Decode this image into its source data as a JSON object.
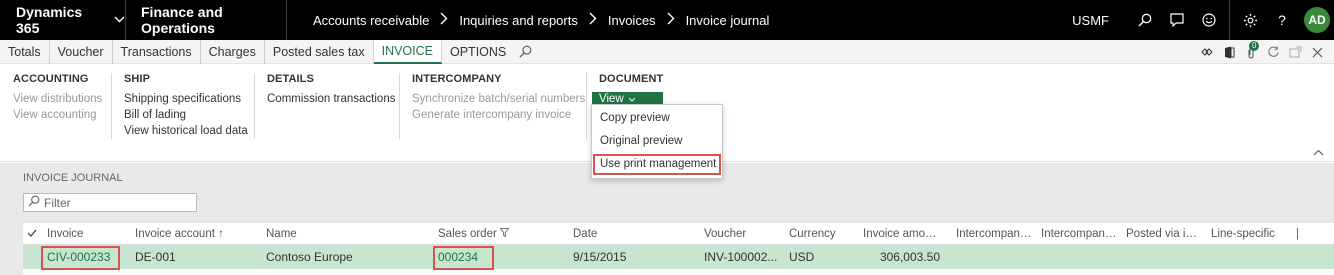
{
  "topbar": {
    "app_name": "Dynamics 365",
    "module_name": "Finance and Operations",
    "breadcrumbs": [
      "Accounts receivable",
      "Inquiries and reports",
      "Invoices",
      "Invoice journal"
    ],
    "company": "USMF",
    "avatar_initials": "AD"
  },
  "tabs": [
    "Totals",
    "Voucher",
    "Transactions",
    "Charges",
    "Posted sales tax",
    "INVOICE",
    "OPTIONS"
  ],
  "active_tab": "INVOICE",
  "notification_count": "0",
  "ribbon": {
    "accounting": {
      "header": "ACCOUNTING",
      "items": [
        "View distributions",
        "View accounting"
      ]
    },
    "ship": {
      "header": "SHIP",
      "items": [
        "Shipping specifications",
        "Bill of lading",
        "View historical load data"
      ]
    },
    "details": {
      "header": "DETAILS",
      "items": [
        "Commission transactions"
      ]
    },
    "intercompany": {
      "header": "INTERCOMPANY",
      "items": [
        "Synchronize batch/serial numbers",
        "Generate intercompany invoice"
      ]
    },
    "document": {
      "header": "DOCUMENT",
      "view_label": "View"
    }
  },
  "view_menu": {
    "items": [
      "Copy preview",
      "Original preview",
      "Use print management"
    ]
  },
  "journal": {
    "title": "INVOICE JOURNAL",
    "filter_placeholder": "Filter",
    "columns": [
      "Invoice",
      "Invoice account",
      "Name",
      "Sales order",
      "Date",
      "Voucher",
      "Currency",
      "Invoice amount",
      "Intercompany...",
      "Intercompany...",
      "Posted via int...",
      "Line-specific"
    ],
    "rows": [
      {
        "invoice": "CIV-000233",
        "invoice_account": "DE-001",
        "name": "Contoso Europe",
        "sales_order": "000234",
        "date": "9/15/2015",
        "voucher": "INV-100002...",
        "currency": "USD",
        "invoice_amount": "306,003.50"
      }
    ]
  },
  "colors": {
    "accent_green": "#217346",
    "highlight_red": "#d9534f",
    "row_selected": "#c7e5cf",
    "topbar_bg": "#000000"
  }
}
